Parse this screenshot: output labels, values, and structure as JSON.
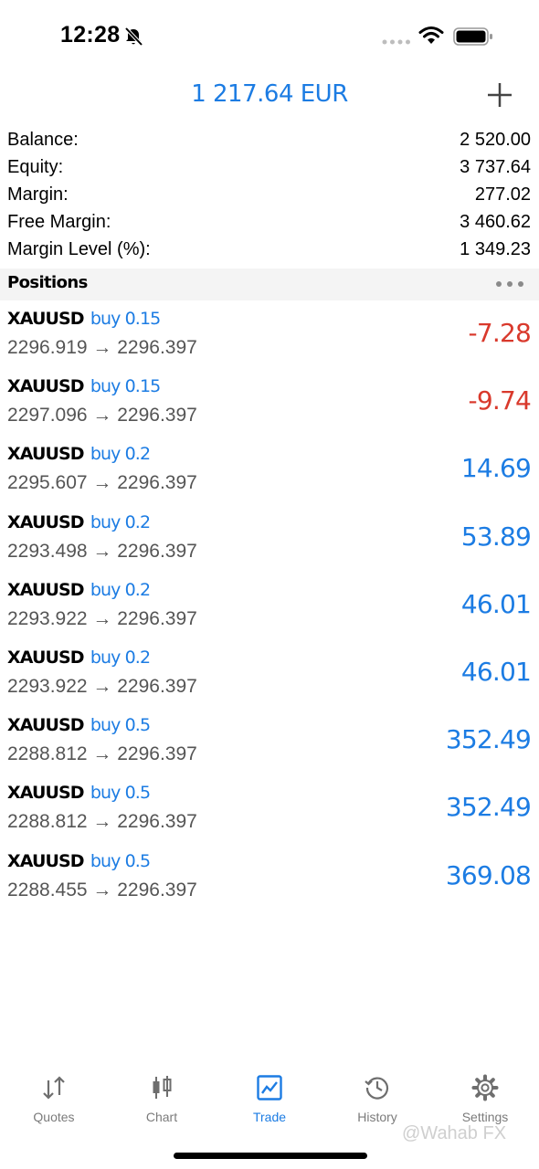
{
  "status_bar": {
    "time": "12:28"
  },
  "header": {
    "title": "1 217.64 EUR"
  },
  "summary": [
    {
      "label": "Balance:",
      "value": "2 520.00"
    },
    {
      "label": "Equity:",
      "value": "3 737.64"
    },
    {
      "label": "Margin:",
      "value": "277.02"
    },
    {
      "label": "Free Margin:",
      "value": "3 460.62"
    },
    {
      "label": "Margin Level (%):",
      "value": "1 349.23"
    }
  ],
  "positions_header": {
    "title": "Positions"
  },
  "positions": [
    {
      "symbol": "XAUUSD",
      "side": "buy 0.15",
      "prices": "2296.919 → 2296.397",
      "profit": "-7.28"
    },
    {
      "symbol": "XAUUSD",
      "side": "buy 0.15",
      "prices": "2297.096 → 2296.397",
      "profit": "-9.74"
    },
    {
      "symbol": "XAUUSD",
      "side": "buy 0.2",
      "prices": "2295.607 → 2296.397",
      "profit": "14.69"
    },
    {
      "symbol": "XAUUSD",
      "side": "buy 0.2",
      "prices": "2293.498 → 2296.397",
      "profit": "53.89"
    },
    {
      "symbol": "XAUUSD",
      "side": "buy 0.2",
      "prices": "2293.922 → 2296.397",
      "profit": "46.01"
    },
    {
      "symbol": "XAUUSD",
      "side": "buy 0.2",
      "prices": "2293.922 → 2296.397",
      "profit": "46.01"
    },
    {
      "symbol": "XAUUSD",
      "side": "buy 0.5",
      "prices": "2288.812 → 2296.397",
      "profit": "352.49"
    },
    {
      "symbol": "XAUUSD",
      "side": "buy 0.5",
      "prices": "2288.812 → 2296.397",
      "profit": "352.49"
    },
    {
      "symbol": "XAUUSD",
      "side": "buy 0.5",
      "prices": "2288.455 → 2296.397",
      "profit": "369.08"
    }
  ],
  "tab_bar": {
    "tabs": [
      {
        "label": "Quotes",
        "icon": "quotes-arrows-icon"
      },
      {
        "label": "Chart",
        "icon": "candlestick-icon"
      },
      {
        "label": "Trade",
        "icon": "trade-chart-icon",
        "active": true
      },
      {
        "label": "History",
        "icon": "history-clock-icon"
      },
      {
        "label": "Settings",
        "icon": "gear-icon"
      }
    ]
  },
  "watermark": "@Wahab FX",
  "colors": {
    "accent": "#1c7ce3",
    "negative": "#d9392c",
    "inactive_tab": "#7b7b7b",
    "section_bg": "#f4f4f4"
  }
}
